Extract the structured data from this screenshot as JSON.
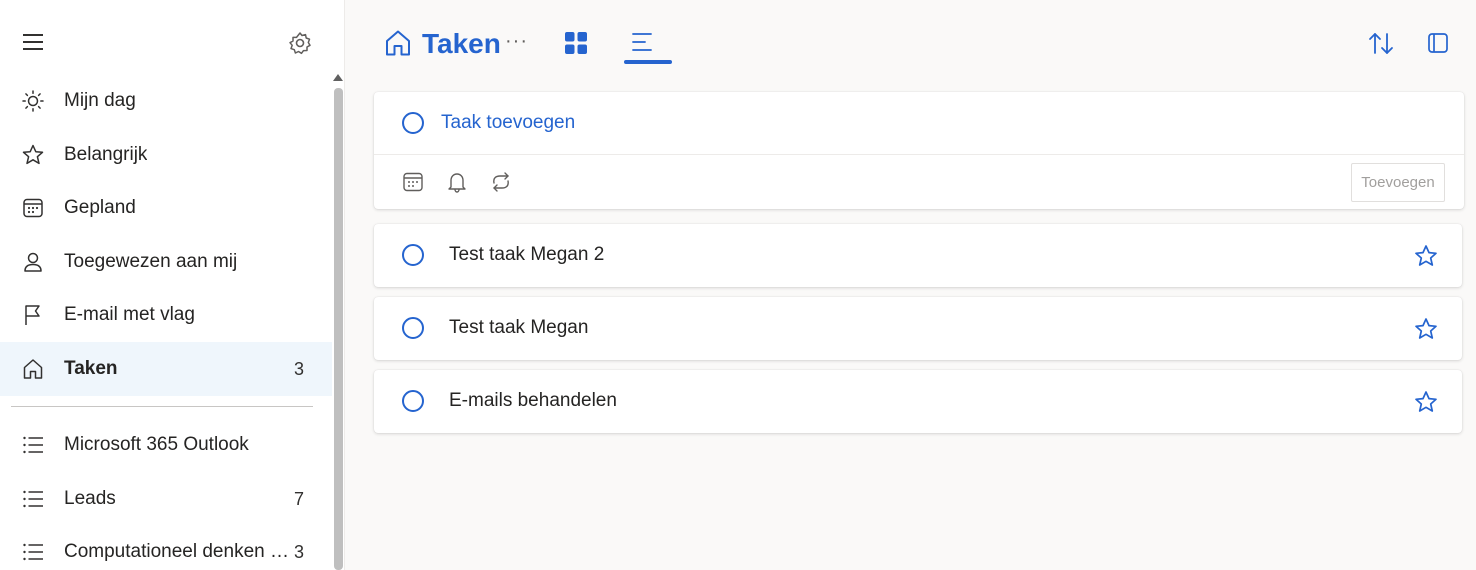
{
  "sidebar": {
    "items": [
      {
        "label": "Mijn dag",
        "icon": "sun-icon",
        "count": ""
      },
      {
        "label": "Belangrijk",
        "icon": "star-icon",
        "count": ""
      },
      {
        "label": "Gepland",
        "icon": "calendar-icon",
        "count": ""
      },
      {
        "label": "Toegewezen aan mij",
        "icon": "person-icon",
        "count": ""
      },
      {
        "label": "E-mail met vlag",
        "icon": "flag-icon",
        "count": ""
      },
      {
        "label": "Taken",
        "icon": "home-icon",
        "count": "3",
        "selected": true
      }
    ],
    "lists": [
      {
        "label": "Microsoft 365 Outlook",
        "icon": "list-icon",
        "count": ""
      },
      {
        "label": "Leads",
        "icon": "list-icon",
        "count": "7"
      },
      {
        "label": "Computationeel denken in de...",
        "icon": "list-icon",
        "count": "3"
      }
    ]
  },
  "header": {
    "title": "Taken",
    "more": "···"
  },
  "add_task": {
    "placeholder": "Taak toevoegen",
    "add_button_label": "Toevoegen"
  },
  "tasks": [
    {
      "title": "Test taak Megan 2"
    },
    {
      "title": "Test taak Megan"
    },
    {
      "title": "E-mails behandelen"
    }
  ],
  "colors": {
    "accent": "#2564cf",
    "selected_bg": "#eff6fc"
  }
}
